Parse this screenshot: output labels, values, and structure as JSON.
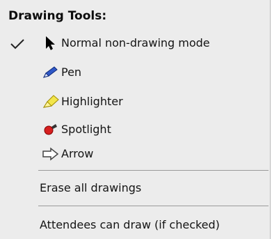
{
  "menu": {
    "title": "Drawing Tools:",
    "items": [
      {
        "label": "Normal non-drawing mode",
        "icon": "cursor-arrow-icon",
        "checked": true
      },
      {
        "label": "Pen",
        "icon": "pen-icon"
      },
      {
        "label": "Highlighter",
        "icon": "highlighter-icon"
      },
      {
        "label": "Spotlight",
        "icon": "spotlight-icon"
      },
      {
        "label": "Arrow",
        "icon": "arrow-icon"
      }
    ],
    "erase_label": "Erase all drawings",
    "attendees_label": "Attendees can draw (if checked)"
  }
}
